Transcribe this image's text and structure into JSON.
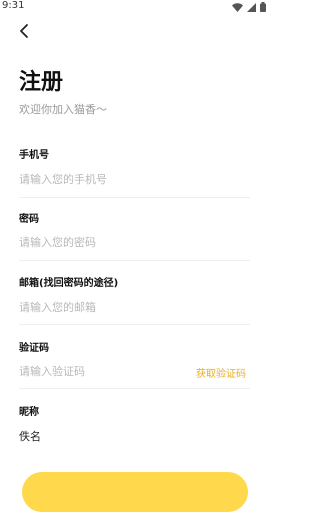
{
  "status_bar": {
    "time": "9:31"
  },
  "header": {
    "title": "注册",
    "subtitle": "欢迎你加入猫香～"
  },
  "form": {
    "phone": {
      "label": "手机号",
      "placeholder": "请输入您的手机号"
    },
    "password": {
      "label": "密码",
      "placeholder": "请输入您的密码"
    },
    "email": {
      "label": "邮箱(找回密码的途径)",
      "placeholder": "请输入您的邮箱"
    },
    "code": {
      "label": "验证码",
      "placeholder": "请输入验证码",
      "get_code_label": "获取验证码"
    },
    "nickname": {
      "label": "昵称",
      "value": "佚名"
    }
  },
  "colors": {
    "accent": "#e9ad22",
    "button": "#ffd84c"
  },
  "icons": [
    "back-arrow-icon",
    "wifi-icon",
    "signal-icon",
    "battery-icon"
  ]
}
